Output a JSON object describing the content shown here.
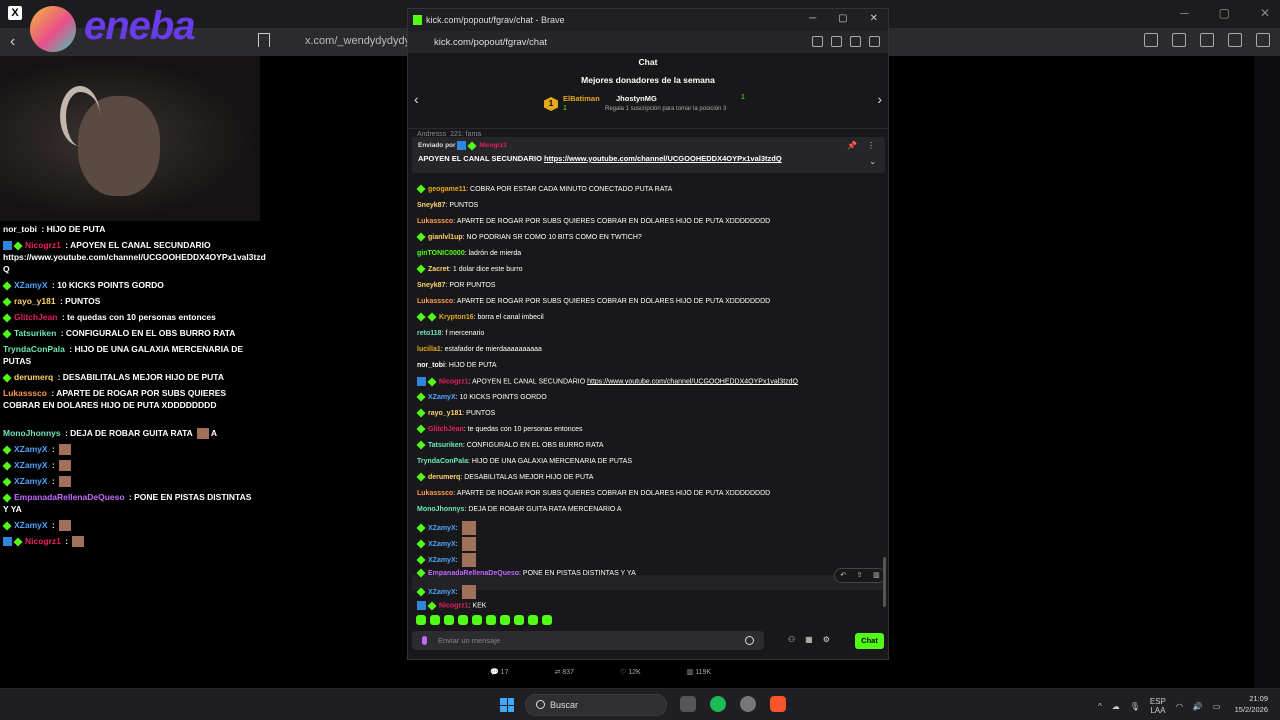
{
  "browser": {
    "url_left": "x.com/_wendydydydy/sta",
    "tab_logo": "eneba"
  },
  "popup": {
    "window_title": "kick.com/popout/fgrav/chat - Brave",
    "url": "kick.com/popout/fgrav/chat",
    "chat_title": "Chat",
    "donors_title": "Mejores donadores de la semana",
    "donor1": {
      "rank": "1",
      "name": "ElBatiman",
      "count": "1"
    },
    "donor2": {
      "name": "JhostynMG",
      "count": "1",
      "subtitle": "Regala 1 suscripción para tomar la posición 3"
    },
    "pinned": {
      "by": "Enviado por",
      "by_user": "Nicogrz1",
      "text": "APOYEN EL CANAL SECUNDARIO",
      "link": "https://www.youtube.com/channel/UCGOOHEDDX4OYPx1val3tzdQ"
    },
    "input_placeholder": "Enviar un mensaje",
    "send_label": "Chat",
    "partial_top": "Andresss_221: fama"
  },
  "messages": [
    {
      "user": "geogame11",
      "color": "#e6a91a",
      "text": "COBRA POR ESTAR CADA MINUTO CONECTADO PUTA RATA",
      "badge": "g"
    },
    {
      "user": "Sneyk87",
      "color": "#ffd36b",
      "text": "PUNTOS",
      "badge": ""
    },
    {
      "user": "Lukasssco",
      "color": "#ff9a4d",
      "text": "APARTE DE ROGAR POR SUBS QUIERES COBRAR EN DOLARES HIJO DE PUTA XDDDDDDDD",
      "badge": ""
    },
    {
      "user": "gianlvl1up",
      "color": "#ffd36b",
      "text": "NO PODRIAN SR COMO 10 BITS COMO EN TWTICH?",
      "badge": "g"
    },
    {
      "user": "ginTONIC0000",
      "color": "#53fc18",
      "text": "ladrón de mierda",
      "badge": ""
    },
    {
      "user": "Zacret",
      "color": "#ffd36b",
      "text": "1 dolar dice este burro",
      "badge": "g"
    },
    {
      "user": "Sneyk87",
      "color": "#ffd36b",
      "text": "POR PUNTOS",
      "badge": ""
    },
    {
      "user": "Lukasssco",
      "color": "#ff9a4d",
      "text": "APARTE DE ROGAR POR SUBS QUIERES COBRAR EN DOLARES HIJO DE PUTA XDDDDDDDD",
      "badge": ""
    },
    {
      "user": "Krypton16",
      "color": "#e6a91a",
      "text": "borra el canal imbecil",
      "badge": "gg"
    },
    {
      "user": "reto118",
      "color": "#6ee7b7",
      "text": "f mercenario",
      "badge": ""
    },
    {
      "user": "lucilla1",
      "color": "#e6a91a",
      "text": "estafador de mierdaaaaaaaaaa",
      "badge": ""
    },
    {
      "user": "nor_tobi",
      "color": "#ffffff",
      "text": "HIJO DE PUTA",
      "badge": ""
    },
    {
      "user": "Nicogrz1",
      "color": "#e91e63",
      "text": "APOYEN EL CANAL SECUNDARIO",
      "link": "https://www.youtube.com/channel/UCGOOHEDDX4OYPx1val3tzdQ",
      "badge": "bg"
    },
    {
      "user": "XZamyX",
      "color": "#4ea3ff",
      "text": "10 KICKS POINTS GORDO",
      "badge": "g"
    },
    {
      "user": "rayo_y181",
      "color": "#ffd36b",
      "text": "PUNTOS",
      "badge": "g"
    },
    {
      "user": "GlitchJean",
      "color": "#e91e63",
      "text": "te quedas con 10 personas entonces",
      "badge": "g"
    },
    {
      "user": "Tatsuriken",
      "color": "#6ee7b7",
      "text": "CONFIGURALO EN EL OBS BURRO RATA",
      "badge": "g"
    },
    {
      "user": "TryndaConPala",
      "color": "#6ee7b7",
      "text": "HIJO DE UNA GALAXIA MERCENARIA DE PUTAS",
      "badge": ""
    },
    {
      "user": "derumerq",
      "color": "#ffd36b",
      "text": "DESABILITALAS MEJOR HIJO DE PUTA",
      "badge": "g"
    },
    {
      "user": "Lukasssco",
      "color": "#ff9a4d",
      "text": "APARTE DE ROGAR POR SUBS QUIERES COBRAR EN DOLARES HIJO DE PUTA XDDDDDDDD",
      "badge": ""
    },
    {
      "user": "MonoJhonnys",
      "color": "#6ee7b7",
      "text": "DEJA DE ROBAR GUITA RATA MERCENARIO A",
      "badge": ""
    },
    {
      "user": "XZamyX",
      "color": "#4ea3ff",
      "text": "",
      "badge": "g",
      "emote": true
    },
    {
      "user": "XZamyX",
      "color": "#4ea3ff",
      "text": "",
      "badge": "g",
      "emote": true
    },
    {
      "user": "XZamyX",
      "color": "#4ea3ff",
      "text": "",
      "badge": "g",
      "emote": true
    },
    {
      "user": "EmpanadaRellenaDeQueso",
      "color": "#c36bff",
      "text": "PONE EN PISTAS DISTINTAS Y YA",
      "badge": "g"
    },
    {
      "user": "XZamyX",
      "color": "#4ea3ff",
      "text": "",
      "badge": "g",
      "emote": true
    },
    {
      "user": "Nicogrz1",
      "color": "#e91e63",
      "text": "KEK",
      "badge": "bg"
    }
  ],
  "overlay": [
    {
      "user": "nor_tobi",
      "color": "#ffffff",
      "text": "HIJO DE PUTA",
      "badge": ""
    },
    {
      "user": "Nicogrz1",
      "color": "#e91e63",
      "text": "APOYEN EL CANAL SECUNDARIO https://www.youtube.com/channel/UCGOOHEDDX4OYPx1val3tzd Q",
      "badge": "bg"
    },
    {
      "user": "XZamyX",
      "color": "#4ea3ff",
      "text": "10 KICKS POINTS GORDO",
      "badge": "g"
    },
    {
      "user": "rayo_y181",
      "color": "#ffd36b",
      "text": "PUNTOS",
      "badge": "g"
    },
    {
      "user": "GlitchJean",
      "color": "#e91e63",
      "text": "te quedas con 10 personas entonces",
      "badge": "g"
    },
    {
      "user": "Tatsuriken",
      "color": "#6ee7b7",
      "text": "CONFIGURALO EN EL OBS BURRO RATA",
      "badge": "g"
    },
    {
      "user": "TryndaConPala",
      "color": "#6ee7b7",
      "text": "HIJO DE UNA GALAXIA MERCENARIA DE PUTAS",
      "badge": ""
    },
    {
      "user": "derumerq",
      "color": "#ffd36b",
      "text": "DESABILITALAS MEJOR HIJO DE PUTA",
      "badge": "g"
    },
    {
      "user": "Lukasssco",
      "color": "#ff9a4d",
      "text": "APARTE DE ROGAR POR SUBS QUIERES COBRAR EN DOLARES HIJO DE PUTA XDDDDDDDD",
      "badge": ""
    },
    {
      "user": "MonoJhonnys",
      "color": "#6ee7b7",
      "text": "DEJA DE ROBAR GUITA RATA",
      "badge": "",
      "suffix": "A"
    },
    {
      "user": "XZamyX",
      "color": "#4ea3ff",
      "text": "",
      "badge": "g",
      "emote": true
    },
    {
      "user": "XZamyX",
      "color": "#4ea3ff",
      "text": "",
      "badge": "g",
      "emote": true
    },
    {
      "user": "XZamyX",
      "color": "#4ea3ff",
      "text": "",
      "badge": "g",
      "emote": true
    },
    {
      "user": "EmpanadaRellenaDeQueso",
      "color": "#c36bff",
      "text": "PONE EN PISTAS DISTINTAS Y YA",
      "badge": "g"
    },
    {
      "user": "XZamyX",
      "color": "#4ea3ff",
      "text": "",
      "badge": "g",
      "emote": true
    },
    {
      "user": "Nicogrz1",
      "color": "#e91e63",
      "text": "",
      "badge": "bg",
      "emote": true
    }
  ],
  "tweet": {
    "replies": "17",
    "reposts": "837",
    "likes": "12K",
    "views": "119K"
  },
  "taskbar": {
    "search": "Buscar",
    "lang": "ESP",
    "lang2": "LAA",
    "time": "21:09",
    "date": "15/2/2026"
  },
  "colors": {
    "kick_green": "#53fc18",
    "gold": "#e6a91a"
  }
}
